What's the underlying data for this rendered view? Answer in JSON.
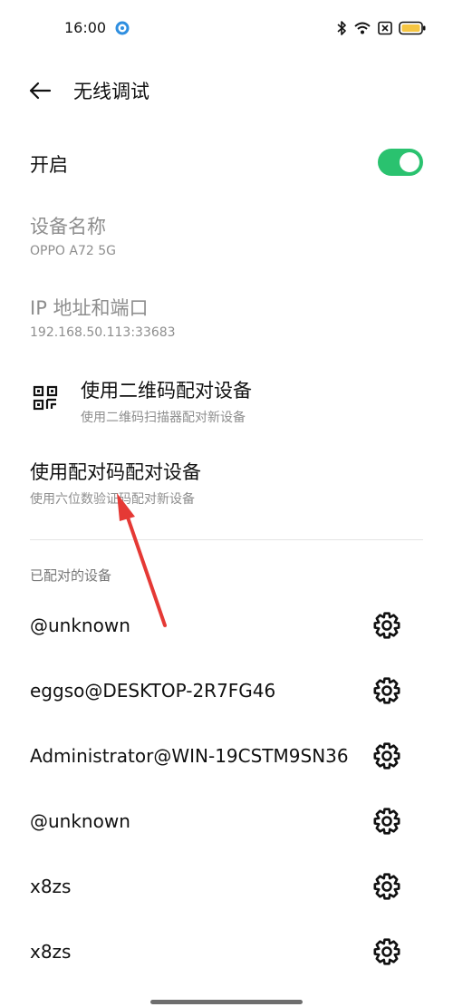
{
  "status_bar": {
    "time": "16:00"
  },
  "header": {
    "title": "无线调试"
  },
  "enable": {
    "label": "开启",
    "on": true,
    "accent": "#2ac26f"
  },
  "device_name": {
    "label": "设备名称",
    "value": "OPPO A72 5G"
  },
  "ip_port": {
    "label": "IP 地址和端口",
    "value": "192.168.50.113:33683"
  },
  "qr_pair": {
    "label": "使用二维码配对设备",
    "desc": "使用二维码扫描器配对新设备"
  },
  "code_pair": {
    "label": "使用配对码配对设备",
    "desc": "使用六位数验证码配对新设备"
  },
  "paired": {
    "header": "已配对的设备",
    "devices": [
      {
        "name": "@unknown"
      },
      {
        "name": "eggso@DESKTOP-2R7FG46"
      },
      {
        "name": "Administrator@WIN-19CSTM9SN36"
      },
      {
        "name": "@unknown"
      },
      {
        "name": "x8zs"
      },
      {
        "name": "x8zs"
      }
    ]
  },
  "icons": {
    "back": "arrow-left-icon",
    "qr": "qr-code-icon",
    "settings": "gear-icon",
    "bluetooth": "bluetooth-icon",
    "wifi": "wifi-icon",
    "battery": "battery-icon"
  },
  "annotation": {
    "color": "#e53935"
  }
}
